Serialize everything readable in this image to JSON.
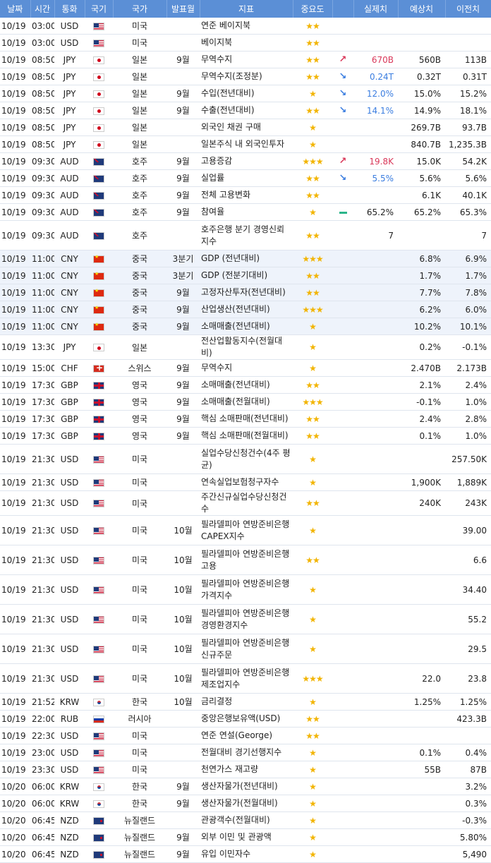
{
  "headers": [
    "날짜",
    "시간",
    "통화",
    "국기",
    "국가",
    "발표월",
    "지표",
    "중요도",
    "",
    "실제치",
    "예상치",
    "이전치"
  ],
  "rows": [
    {
      "date": "10/19",
      "time": "03:00",
      "cur": "USD",
      "flag": "us-flag-icon",
      "country": "미국",
      "month": "",
      "ind": "연준 베이지북",
      "stars": "★★",
      "trend": "",
      "actual": "",
      "actual_color": "",
      "fcst": "",
      "prev": ""
    },
    {
      "date": "10/19",
      "time": "03:00",
      "cur": "USD",
      "flag": "us-flag-icon",
      "country": "미국",
      "month": "",
      "ind": "베이지북",
      "stars": "★★",
      "trend": "",
      "actual": "",
      "actual_color": "",
      "fcst": "",
      "prev": ""
    },
    {
      "date": "10/19",
      "time": "08:50",
      "cur": "JPY",
      "flag": "jp-flag-icon",
      "country": "일본",
      "month": "9월",
      "ind": "무역수지",
      "stars": "★★",
      "trend": "up",
      "actual": "670B",
      "actual_color": "pos",
      "fcst": "560B",
      "prev": "113B"
    },
    {
      "date": "10/19",
      "time": "08:50",
      "cur": "JPY",
      "flag": "jp-flag-icon",
      "country": "일본",
      "month": "",
      "ind": "무역수지(조정분)",
      "stars": "★★",
      "trend": "down",
      "actual": "0.24T",
      "actual_color": "neg",
      "fcst": "0.32T",
      "prev": "0.31T"
    },
    {
      "date": "10/19",
      "time": "08:50",
      "cur": "JPY",
      "flag": "jp-flag-icon",
      "country": "일본",
      "month": "9월",
      "ind": "수입(전년대비)",
      "stars": "★",
      "trend": "down",
      "actual": "12.0%",
      "actual_color": "neg",
      "fcst": "15.0%",
      "prev": "15.2%"
    },
    {
      "date": "10/19",
      "time": "08:50",
      "cur": "JPY",
      "flag": "jp-flag-icon",
      "country": "일본",
      "month": "9월",
      "ind": "수출(전년대비)",
      "stars": "★★",
      "trend": "down",
      "actual": "14.1%",
      "actual_color": "neg",
      "fcst": "14.9%",
      "prev": "18.1%"
    },
    {
      "date": "10/19",
      "time": "08:50",
      "cur": "JPY",
      "flag": "jp-flag-icon",
      "country": "일본",
      "month": "",
      "ind": "외국인 채권 구매",
      "stars": "★",
      "trend": "",
      "actual": "",
      "actual_color": "",
      "fcst": "269.7B",
      "prev": "93.7B"
    },
    {
      "date": "10/19",
      "time": "08:50",
      "cur": "JPY",
      "flag": "jp-flag-icon",
      "country": "일본",
      "month": "",
      "ind": "일본주식 내 외국인투자",
      "stars": "★",
      "trend": "",
      "actual": "",
      "actual_color": "",
      "fcst": "840.7B",
      "prev": "1,235.3B"
    },
    {
      "date": "10/19",
      "time": "09:30",
      "cur": "AUD",
      "flag": "au-flag-icon",
      "country": "호주",
      "month": "9월",
      "ind": "고용증감",
      "stars": "★★★",
      "trend": "up",
      "actual": "19.8K",
      "actual_color": "pos",
      "fcst": "15.0K",
      "prev": "54.2K"
    },
    {
      "date": "10/19",
      "time": "09:30",
      "cur": "AUD",
      "flag": "au-flag-icon",
      "country": "호주",
      "month": "9월",
      "ind": "실업률",
      "stars": "★★",
      "trend": "down",
      "actual": "5.5%",
      "actual_color": "neg",
      "fcst": "5.6%",
      "prev": "5.6%"
    },
    {
      "date": "10/19",
      "time": "09:30",
      "cur": "AUD",
      "flag": "au-flag-icon",
      "country": "호주",
      "month": "9월",
      "ind": "전체 고용변화",
      "stars": "★★",
      "trend": "",
      "actual": "",
      "actual_color": "",
      "fcst": "6.1K",
      "prev": "40.1K"
    },
    {
      "date": "10/19",
      "time": "09:30",
      "cur": "AUD",
      "flag": "au-flag-icon",
      "country": "호주",
      "month": "9월",
      "ind": "참여율",
      "stars": "★",
      "trend": "flat",
      "actual": "65.2%",
      "actual_color": "",
      "fcst": "65.2%",
      "prev": "65.3%"
    },
    {
      "date": "10/19",
      "time": "09:30",
      "cur": "AUD",
      "flag": "au-flag-icon",
      "country": "호주",
      "month": "",
      "ind": "호주은행 분기 경영신뢰지수",
      "stars": "★★",
      "trend": "",
      "actual": "7",
      "actual_color": "",
      "fcst": "",
      "prev": "7",
      "tall": true
    },
    {
      "date": "10/19",
      "time": "11:00",
      "cur": "CNY",
      "flag": "cn-flag-icon",
      "country": "중국",
      "month": "3분기",
      "ind": "GDP (전년대비)",
      "stars": "★★★",
      "trend": "",
      "actual": "",
      "actual_color": "",
      "fcst": "6.8%",
      "prev": "6.9%",
      "hl": true
    },
    {
      "date": "10/19",
      "time": "11:00",
      "cur": "CNY",
      "flag": "cn-flag-icon",
      "country": "중국",
      "month": "3분기",
      "ind": "GDP (전분기대비)",
      "stars": "★★",
      "trend": "",
      "actual": "",
      "actual_color": "",
      "fcst": "1.7%",
      "prev": "1.7%",
      "hl": true
    },
    {
      "date": "10/19",
      "time": "11:00",
      "cur": "CNY",
      "flag": "cn-flag-icon",
      "country": "중국",
      "month": "9월",
      "ind": "고정자산투자(전년대비)",
      "stars": "★★",
      "trend": "",
      "actual": "",
      "actual_color": "",
      "fcst": "7.7%",
      "prev": "7.8%",
      "hl": true
    },
    {
      "date": "10/19",
      "time": "11:00",
      "cur": "CNY",
      "flag": "cn-flag-icon",
      "country": "중국",
      "month": "9월",
      "ind": "산업생산(전년대비)",
      "stars": "★★★",
      "trend": "",
      "actual": "",
      "actual_color": "",
      "fcst": "6.2%",
      "prev": "6.0%",
      "hl": true
    },
    {
      "date": "10/19",
      "time": "11:00",
      "cur": "CNY",
      "flag": "cn-flag-icon",
      "country": "중국",
      "month": "9월",
      "ind": "소매매출(전년대비)",
      "stars": "★",
      "trend": "",
      "actual": "",
      "actual_color": "",
      "fcst": "10.2%",
      "prev": "10.1%",
      "hl": true
    },
    {
      "date": "10/19",
      "time": "13:30",
      "cur": "JPY",
      "flag": "jp-flag-icon",
      "country": "일본",
      "month": "",
      "ind": "전산업활동지수(전월대비)",
      "stars": "★",
      "trend": "",
      "actual": "",
      "actual_color": "",
      "fcst": "0.2%",
      "prev": "-0.1%"
    },
    {
      "date": "10/19",
      "time": "15:00",
      "cur": "CHF",
      "flag": "ch-flag-icon",
      "country": "스위스",
      "month": "9월",
      "ind": "무역수지",
      "stars": "★",
      "trend": "",
      "actual": "",
      "actual_color": "",
      "fcst": "2.470B",
      "prev": "2.173B"
    },
    {
      "date": "10/19",
      "time": "17:30",
      "cur": "GBP",
      "flag": "gb-flag-icon",
      "country": "영국",
      "month": "9월",
      "ind": "소매매출(전년대비)",
      "stars": "★★",
      "trend": "",
      "actual": "",
      "actual_color": "",
      "fcst": "2.1%",
      "prev": "2.4%"
    },
    {
      "date": "10/19",
      "time": "17:30",
      "cur": "GBP",
      "flag": "gb-flag-icon",
      "country": "영국",
      "month": "9월",
      "ind": "소매매출(전월대비)",
      "stars": "★★★",
      "trend": "",
      "actual": "",
      "actual_color": "",
      "fcst": "-0.1%",
      "prev": "1.0%"
    },
    {
      "date": "10/19",
      "time": "17:30",
      "cur": "GBP",
      "flag": "gb-flag-icon",
      "country": "영국",
      "month": "9월",
      "ind": "핵심 소매판매(전년대비)",
      "stars": "★★",
      "trend": "",
      "actual": "",
      "actual_color": "",
      "fcst": "2.4%",
      "prev": "2.8%"
    },
    {
      "date": "10/19",
      "time": "17:30",
      "cur": "GBP",
      "flag": "gb-flag-icon",
      "country": "영국",
      "month": "9월",
      "ind": "핵심 소매판매(전월대비)",
      "stars": "★★",
      "trend": "",
      "actual": "",
      "actual_color": "",
      "fcst": "0.1%",
      "prev": "1.0%"
    },
    {
      "date": "10/19",
      "time": "21:30",
      "cur": "USD",
      "flag": "us-flag-icon",
      "country": "미국",
      "month": "",
      "ind": "실업수당신청건수(4주 평균)",
      "stars": "★",
      "trend": "",
      "actual": "",
      "actual_color": "",
      "fcst": "",
      "prev": "257.50K",
      "tall": true
    },
    {
      "date": "10/19",
      "time": "21:30",
      "cur": "USD",
      "flag": "us-flag-icon",
      "country": "미국",
      "month": "",
      "ind": "연속실업보험청구자수",
      "stars": "★",
      "trend": "",
      "actual": "",
      "actual_color": "",
      "fcst": "1,900K",
      "prev": "1,889K"
    },
    {
      "date": "10/19",
      "time": "21:30",
      "cur": "USD",
      "flag": "us-flag-icon",
      "country": "미국",
      "month": "",
      "ind": "주간신규실업수당신청건수",
      "stars": "★★",
      "trend": "",
      "actual": "",
      "actual_color": "",
      "fcst": "240K",
      "prev": "243K"
    },
    {
      "date": "10/19",
      "time": "21:30",
      "cur": "USD",
      "flag": "us-flag-icon",
      "country": "미국",
      "month": "10월",
      "ind": "필라델피아 연방준비은행 CAPEX지수",
      "stars": "★",
      "trend": "",
      "actual": "",
      "actual_color": "",
      "fcst": "",
      "prev": "39.00",
      "tall": true
    },
    {
      "date": "10/19",
      "time": "21:30",
      "cur": "USD",
      "flag": "us-flag-icon",
      "country": "미국",
      "month": "10월",
      "ind": "필라델피아 연방준비은행 고용",
      "stars": "★★",
      "trend": "",
      "actual": "",
      "actual_color": "",
      "fcst": "",
      "prev": "6.6",
      "tall": true
    },
    {
      "date": "10/19",
      "time": "21:30",
      "cur": "USD",
      "flag": "us-flag-icon",
      "country": "미국",
      "month": "10월",
      "ind": "필라델피아 연방준비은행 가격지수",
      "stars": "★",
      "trend": "",
      "actual": "",
      "actual_color": "",
      "fcst": "",
      "prev": "34.40",
      "tall": true
    },
    {
      "date": "10/19",
      "time": "21:30",
      "cur": "USD",
      "flag": "us-flag-icon",
      "country": "미국",
      "month": "10월",
      "ind": "필라델피아 연방준비은행 경영환경지수",
      "stars": "★",
      "trend": "",
      "actual": "",
      "actual_color": "",
      "fcst": "",
      "prev": "55.2",
      "tall": true
    },
    {
      "date": "10/19",
      "time": "21:30",
      "cur": "USD",
      "flag": "us-flag-icon",
      "country": "미국",
      "month": "10월",
      "ind": "필라델피아 연방준비은행 신규주문",
      "stars": "★",
      "trend": "",
      "actual": "",
      "actual_color": "",
      "fcst": "",
      "prev": "29.5",
      "tall": true
    },
    {
      "date": "10/19",
      "time": "21:30",
      "cur": "USD",
      "flag": "us-flag-icon",
      "country": "미국",
      "month": "10월",
      "ind": "필라델피아 연방준비은행 제조업지수",
      "stars": "★★★",
      "trend": "",
      "actual": "",
      "actual_color": "",
      "fcst": "22.0",
      "prev": "23.8",
      "tall": true
    },
    {
      "date": "10/19",
      "time": "21:52",
      "cur": "KRW",
      "flag": "kr-flag-icon",
      "country": "한국",
      "month": "10월",
      "ind": "금리결정",
      "stars": "★",
      "trend": "",
      "actual": "",
      "actual_color": "",
      "fcst": "1.25%",
      "prev": "1.25%"
    },
    {
      "date": "10/19",
      "time": "22:00",
      "cur": "RUB",
      "flag": "ru-flag-icon",
      "country": "러시아",
      "month": "",
      "ind": "중앙은행보유액(USD)",
      "stars": "★★",
      "trend": "",
      "actual": "",
      "actual_color": "",
      "fcst": "",
      "prev": "423.3B"
    },
    {
      "date": "10/19",
      "time": "22:30",
      "cur": "USD",
      "flag": "us-flag-icon",
      "country": "미국",
      "month": "",
      "ind": "연준 연설(George)",
      "stars": "★★",
      "trend": "",
      "actual": "",
      "actual_color": "",
      "fcst": "",
      "prev": ""
    },
    {
      "date": "10/19",
      "time": "23:00",
      "cur": "USD",
      "flag": "us-flag-icon",
      "country": "미국",
      "month": "",
      "ind": "전월대비 경기선행지수",
      "stars": "★",
      "trend": "",
      "actual": "",
      "actual_color": "",
      "fcst": "0.1%",
      "prev": "0.4%"
    },
    {
      "date": "10/19",
      "time": "23:30",
      "cur": "USD",
      "flag": "us-flag-icon",
      "country": "미국",
      "month": "",
      "ind": "천연가스 재고량",
      "stars": "★",
      "trend": "",
      "actual": "",
      "actual_color": "",
      "fcst": "55B",
      "prev": "87B"
    },
    {
      "date": "10/20",
      "time": "06:00",
      "cur": "KRW",
      "flag": "kr-flag-icon",
      "country": "한국",
      "month": "9월",
      "ind": "생산자물가(전년대비)",
      "stars": "★",
      "trend": "",
      "actual": "",
      "actual_color": "",
      "fcst": "",
      "prev": "3.2%"
    },
    {
      "date": "10/20",
      "time": "06:00",
      "cur": "KRW",
      "flag": "kr-flag-icon",
      "country": "한국",
      "month": "9월",
      "ind": "생산자물가(전월대비)",
      "stars": "★",
      "trend": "",
      "actual": "",
      "actual_color": "",
      "fcst": "",
      "prev": "0.3%"
    },
    {
      "date": "10/20",
      "time": "06:45",
      "cur": "NZD",
      "flag": "nz-flag-icon",
      "country": "뉴질랜드",
      "month": "",
      "ind": "관광객수(전월대비)",
      "stars": "★",
      "trend": "",
      "actual": "",
      "actual_color": "",
      "fcst": "",
      "prev": "-0.3%"
    },
    {
      "date": "10/20",
      "time": "06:45",
      "cur": "NZD",
      "flag": "nz-flag-icon",
      "country": "뉴질랜드",
      "month": "9월",
      "ind": "외부 이민 및 관광액",
      "stars": "★",
      "trend": "",
      "actual": "",
      "actual_color": "",
      "fcst": "",
      "prev": "5.80%"
    },
    {
      "date": "10/20",
      "time": "06:45",
      "cur": "NZD",
      "flag": "nz-flag-icon",
      "country": "뉴질랜드",
      "month": "9월",
      "ind": "유입 이민자수",
      "stars": "★",
      "trend": "",
      "actual": "",
      "actual_color": "",
      "fcst": "",
      "prev": "5,490"
    }
  ]
}
